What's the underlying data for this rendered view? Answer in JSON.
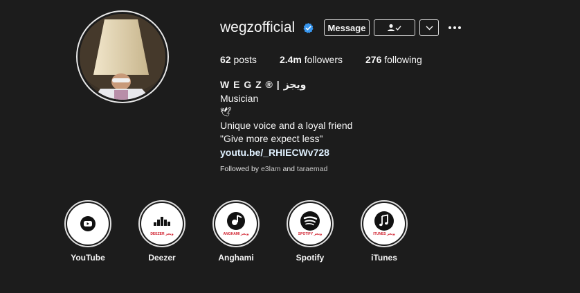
{
  "profile": {
    "username": "wegzofficial",
    "verified": true,
    "buttons": {
      "message": "Message"
    },
    "stats": [
      {
        "value": "62",
        "label": " posts"
      },
      {
        "value": "2.4m",
        "label": " followers"
      },
      {
        "value": "276",
        "label": " following"
      }
    ],
    "bio": {
      "name": "W E G Z ® | ويجز",
      "category": "Musician",
      "emoji": "🕊",
      "line1": "Unique voice and a loyal friend",
      "line2": "\"Give more expect less\"",
      "link": "youtu.be/_RHIECWv728"
    },
    "followed_by": {
      "prefix": "Followed by ",
      "user1": "e3lam",
      "joiner": " and ",
      "user2": "taraemad"
    }
  },
  "highlights": [
    {
      "label": "YouTube",
      "icon": "youtube-icon",
      "tag": ""
    },
    {
      "label": "Deezer",
      "icon": "deezer-icon",
      "tag": "DEEZER ويجز"
    },
    {
      "label": "Anghami",
      "icon": "anghami-icon",
      "tag": "ANGHAMI ويجز"
    },
    {
      "label": "Spotify",
      "icon": "spotify-icon",
      "tag": "SPOTIFY ويجز"
    },
    {
      "label": "iTunes",
      "icon": "itunes-icon",
      "tag": "ITUNES ويجز"
    }
  ],
  "colors": {
    "background": "#1c1c1c",
    "text": "#f5f5f5",
    "verified": "#3897f0",
    "link": "#e0f1ff",
    "muted": "#a8a8a8",
    "highlight_tag": "#d01c2a"
  }
}
